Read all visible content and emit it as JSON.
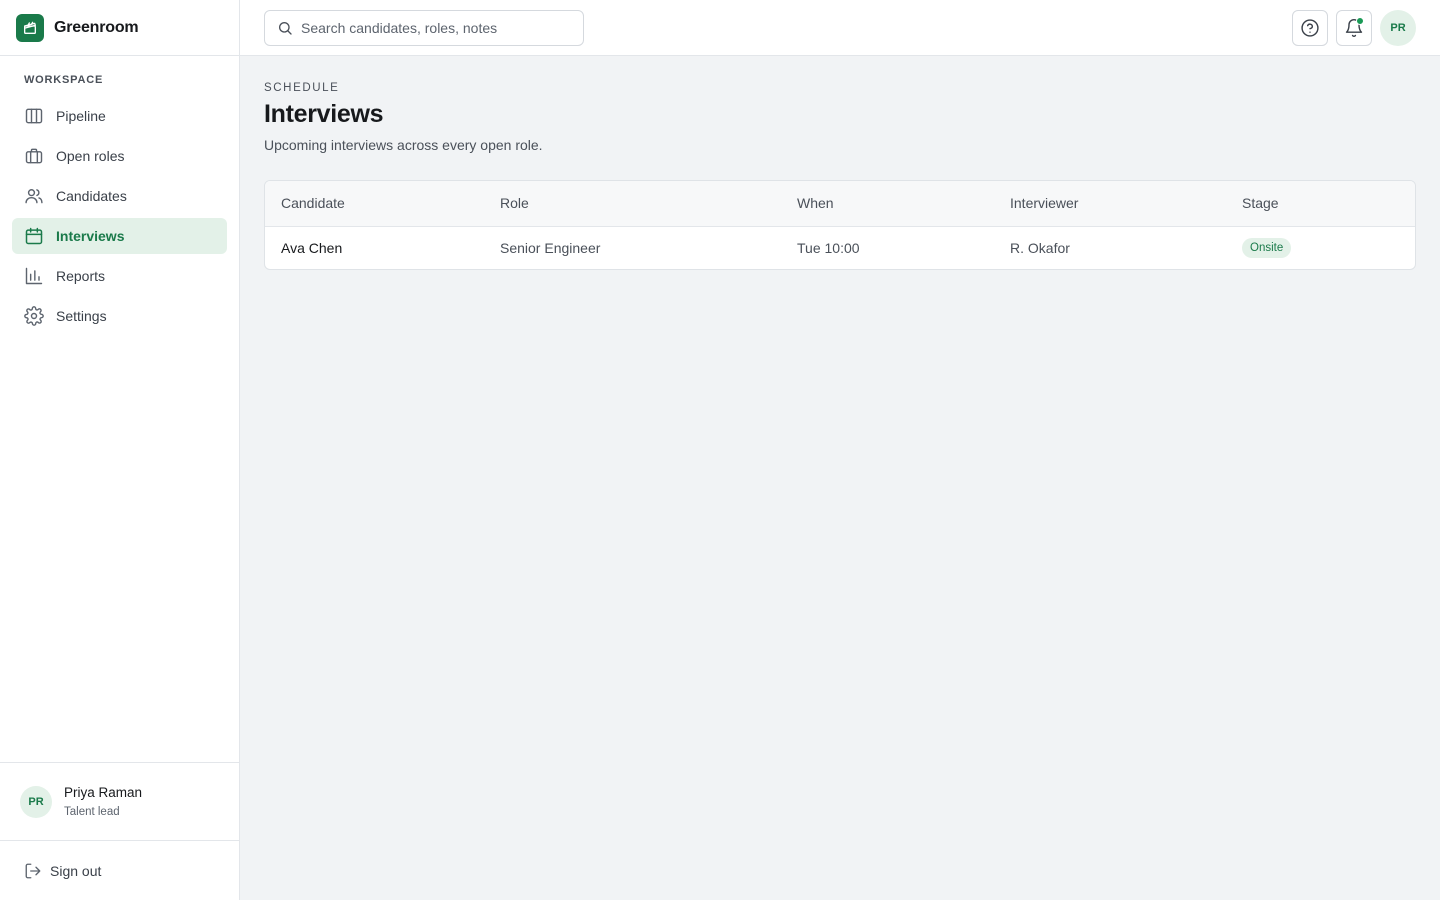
{
  "app": {
    "name": "Greenroom",
    "logo_icon": "clapperboard-icon"
  },
  "sidebar": {
    "section_label": "WORKSPACE",
    "items": [
      {
        "label": "Pipeline",
        "icon": "columns-icon",
        "active": false
      },
      {
        "label": "Open roles",
        "icon": "briefcase-icon",
        "active": false
      },
      {
        "label": "Candidates",
        "icon": "users-icon",
        "active": false
      },
      {
        "label": "Interviews",
        "icon": "calendar-icon",
        "active": true
      },
      {
        "label": "Reports",
        "icon": "bar-chart-icon",
        "active": false
      },
      {
        "label": "Settings",
        "icon": "gear-icon",
        "active": false
      }
    ],
    "user": {
      "initials": "PR",
      "name": "Priya Raman",
      "role": "Talent lead"
    },
    "signout_label": "Sign out"
  },
  "topbar": {
    "search_placeholder": "Search candidates, roles, notes",
    "search_value": "",
    "avatar_initials": "PR",
    "notification_unread": true
  },
  "page": {
    "eyebrow": "SCHEDULE",
    "title": "Interviews",
    "subtitle": "Upcoming interviews across every open role."
  },
  "table": {
    "columns": [
      "Candidate",
      "Role",
      "When",
      "Interviewer",
      "Stage"
    ],
    "rows": [
      {
        "candidate": "Ava Chen",
        "role": "Senior Engineer",
        "when": "Tue 10:00",
        "interviewer": "R. Okafor",
        "stage": "Onsite"
      }
    ]
  },
  "colors": {
    "accent": "#1a7a4a",
    "accent_soft": "#e3f1e8",
    "background": "#f1f3f5"
  }
}
